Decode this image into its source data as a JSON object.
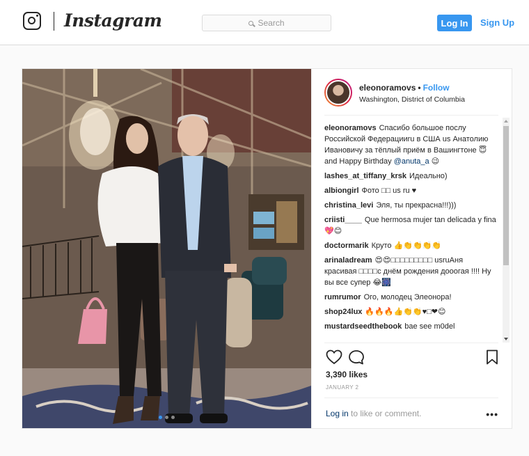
{
  "header": {
    "brand": "Instagram",
    "search_placeholder": "Search",
    "login_label": "Log In",
    "signup_label": "Sign Up"
  },
  "post": {
    "username": "eleonoramovs",
    "separator": "•",
    "follow_label": "Follow",
    "location": "Washington, District of Columbia",
    "comments": [
      {
        "user": "eleonoramovs",
        "text": "Спасибо большое послу Российской Федерацииru в США us Анатолию Ивановичу за тёплый приём в Вашингтоне 😇 and Happy Birthday",
        "mention": "@anuta_a",
        "tail": " 😉"
      },
      {
        "user": "lashes_at_tiffany_krsk",
        "text": "Идеально)"
      },
      {
        "user": "albiongirl",
        "text": "Фото □□ us ru ♥"
      },
      {
        "user": "christina_levi",
        "text": "Эля, ты прекрасна!!!)))"
      },
      {
        "user": "criisti____",
        "text": "Que hermosa mujer tan delicada y fina 💖😊"
      },
      {
        "user": "doctormarik",
        "text": "Круто 👍👏👏👏👏"
      },
      {
        "user": "arinaladream",
        "text": "😍😍□□□□□□□□□ usruАня красивая □□□□с днём рождения дооогая !!!! Ну вы все супер 😂🎆"
      },
      {
        "user": "rumrumor",
        "text": "Ого, молодец Элеонора!"
      },
      {
        "user": "shop24lux",
        "text": "🔥🔥🔥👍👏👏♥□❤😊"
      },
      {
        "user": "mustardseedthebook",
        "text": "bae see m0del"
      }
    ],
    "likes": "3,390 likes",
    "date": "JANUARY 2",
    "login_link": "Log in",
    "login_rest": " to like or comment.",
    "more": "•••",
    "carousel": {
      "count": 3,
      "active": 0
    }
  },
  "icons": {
    "logo": "instagram-camera-icon",
    "search": "search-icon",
    "like": "heart-icon",
    "comment": "comment-bubble-icon",
    "save": "bookmark-icon",
    "more": "more-options-icon"
  },
  "colors": {
    "accent": "#3897f0",
    "text": "#262626",
    "muted": "#999999",
    "link": "#003569"
  }
}
